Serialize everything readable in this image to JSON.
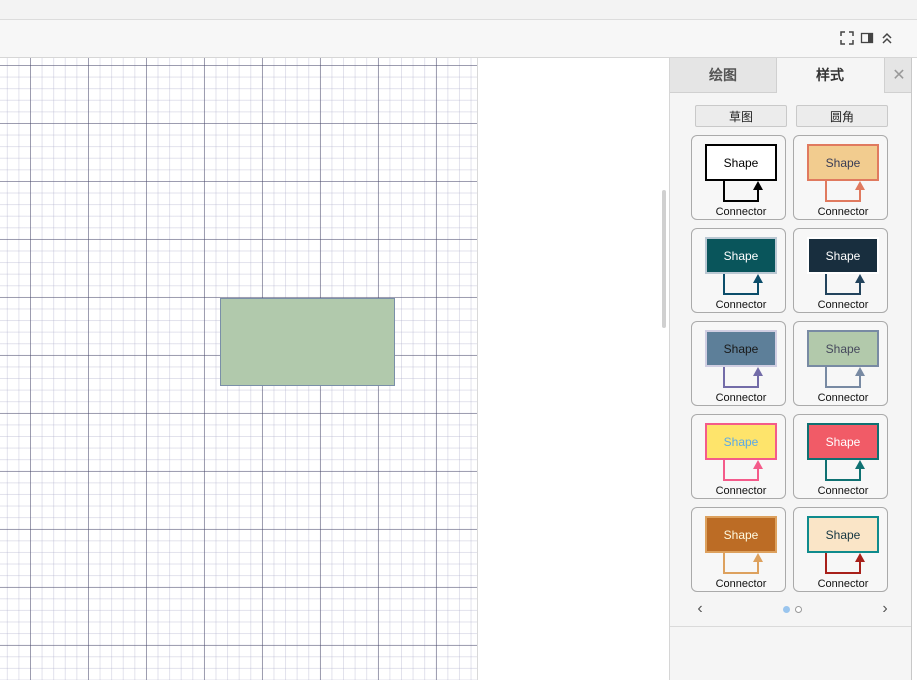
{
  "toolbar": {
    "icons": [
      "fullscreen-icon",
      "format-panel-icon",
      "collapse-icon"
    ]
  },
  "canvas": {
    "selected_shape_fill": "#b1c9ac"
  },
  "panel": {
    "tabs": [
      {
        "label": "绘图"
      },
      {
        "label": "样式"
      }
    ],
    "close_label": "✕",
    "style_buttons": [
      {
        "label": "草图"
      },
      {
        "label": "圆角"
      }
    ],
    "presets": [
      {
        "shape": "Shape",
        "connector": "Connector",
        "fill": "#ffffff",
        "stroke": "#000000",
        "font": "#000000",
        "line": "#000000"
      },
      {
        "shape": "Shape",
        "connector": "Connector",
        "fill": "#f2cc8f",
        "stroke": "#e07a5f",
        "font": "#393c56",
        "line": "#e07a5f"
      },
      {
        "shape": "Shape",
        "connector": "Connector",
        "fill": "#09555b",
        "stroke": "#bac8d3",
        "font": "#ffffff",
        "line": "#0b4d6a"
      },
      {
        "shape": "Shape",
        "connector": "Connector",
        "fill": "#182e3e",
        "stroke": "#ffffff",
        "font": "#ffffff",
        "line": "#23445d"
      },
      {
        "shape": "Shape",
        "connector": "Connector",
        "fill": "#5d7f99",
        "stroke": "#d0cee2",
        "font": "#1a1a1a",
        "line": "#736ca8"
      },
      {
        "shape": "Shape",
        "connector": "Connector",
        "fill": "#b2c9ab",
        "stroke": "#788aa3",
        "font": "#46495d",
        "line": "#788aa3"
      },
      {
        "shape": "Shape",
        "connector": "Connector",
        "fill": "#fee46b",
        "stroke": "#f45b8a",
        "font": "#5aa9e6",
        "line": "#f45b8a"
      },
      {
        "shape": "Shape",
        "connector": "Connector",
        "fill": "#f15b67",
        "stroke": "#0f7172",
        "font": "#ffffff",
        "line": "#0f7172"
      },
      {
        "shape": "Shape",
        "connector": "Connector",
        "fill": "#bc6c25",
        "stroke": "#dda15e",
        "font": "#fefae0",
        "line": "#dda15e"
      },
      {
        "shape": "Shape",
        "connector": "Connector",
        "fill": "#fae5c7",
        "stroke": "#0f8b8d",
        "font": "#143642",
        "line": "#a8201a"
      }
    ],
    "pager": {
      "prev": "‹",
      "next": "›",
      "pages": 2,
      "current": 1,
      "active_color": "#9ac5ee"
    }
  }
}
